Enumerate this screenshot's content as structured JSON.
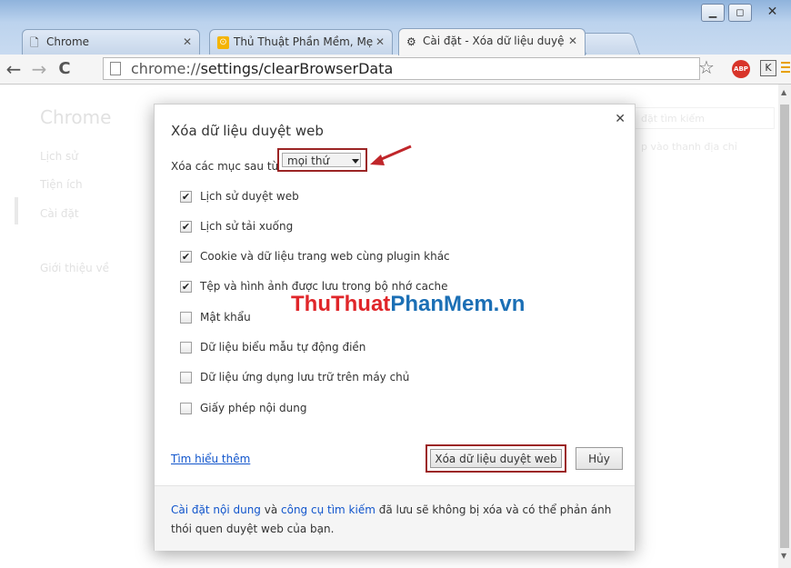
{
  "browser": {
    "tabs": [
      {
        "title": "Chrome",
        "icon": "page-icon"
      },
      {
        "title": "Thủ Thuật Phần Mềm, Mẹ",
        "icon": "site-favicon-icon"
      },
      {
        "title": "Cài đặt - Xóa dữ liệu duyệ",
        "icon": "gear-icon"
      }
    ],
    "url_prefix": "chrome://",
    "url_main": "settings/clearBrowserData",
    "abp_label": "ABP",
    "k_label": "K"
  },
  "settings_bg": {
    "title": "Chrome",
    "nav": [
      "Lịch sử",
      "Tiện ích",
      "Cài đặt",
      "Giới thiệu về"
    ],
    "search_placeholder": "đặt tìm kiếm",
    "search_hint": "p vào thanh địa chỉ"
  },
  "dialog": {
    "title": "Xóa dữ liệu duyệt web",
    "range_label": "Xóa các mục sau từ:",
    "range_value": "mọi thứ",
    "options": [
      {
        "label": "Lịch sử duyệt web",
        "checked": true
      },
      {
        "label": "Lịch sử tải xuống",
        "checked": true
      },
      {
        "label": "Cookie và dữ liệu trang web cùng plugin khác",
        "checked": true
      },
      {
        "label": "Tệp và hình ảnh được lưu trong bộ nhớ cache",
        "checked": true
      },
      {
        "label": "Mật khẩu",
        "checked": false
      },
      {
        "label": "Dữ liệu biểu mẫu tự động điền",
        "checked": false
      },
      {
        "label": "Dữ liệu ứng dụng lưu trữ trên máy chủ",
        "checked": false
      },
      {
        "label": "Giấy phép nội dung",
        "checked": false
      }
    ],
    "learn_more": "Tìm hiểu thêm",
    "clear_button": "Xóa dữ liệu duyệt web",
    "cancel_button": "Hủy",
    "footer_link1": "Cài đặt nội dung",
    "footer_and": " và ",
    "footer_link2": "công cụ tìm kiếm",
    "footer_rest": " đã lưu sẽ không bị xóa và có thể phản ánh thói quen duyệt web của bạn."
  },
  "watermark": {
    "part1": "ThuThuat",
    "part2": "PhanMem",
    "part3": ".vn"
  },
  "colors": {
    "accent_red": "#9b2424",
    "link": "#1155cc",
    "watermark_red": "#e0262a",
    "watermark_blue": "#1b6fb5"
  }
}
